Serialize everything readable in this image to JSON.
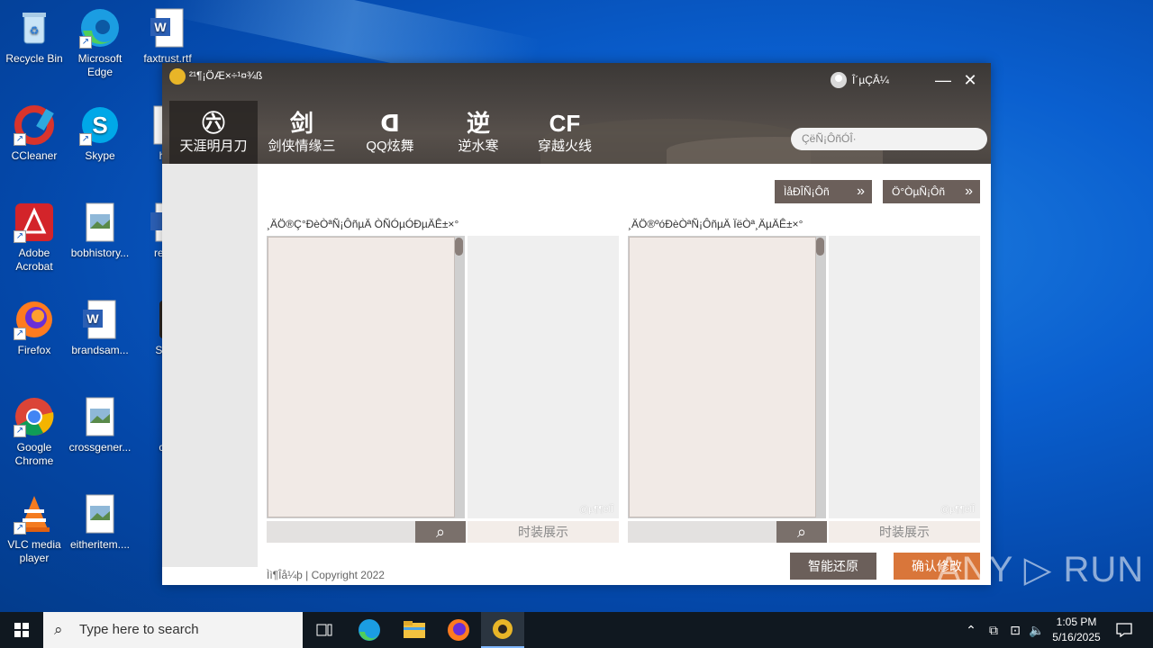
{
  "desktop": {
    "icons": [
      {
        "label": "Recycle Bin",
        "icon": "recycle-bin-icon"
      },
      {
        "label": "Microsoft Edge",
        "icon": "edge-icon"
      },
      {
        "label": "faxtrust.rtf",
        "icon": "word-doc-icon"
      },
      {
        "label": "CCleaner",
        "icon": "ccleaner-icon"
      },
      {
        "label": "Skype",
        "icon": "skype-icon"
      },
      {
        "label": "hist",
        "icon": "file-icon"
      },
      {
        "label": "Adobe Acrobat",
        "icon": "acrobat-icon"
      },
      {
        "label": "bobhistory...",
        "icon": "image-file-icon"
      },
      {
        "label": "ready",
        "icon": "word-doc-icon"
      },
      {
        "label": "Firefox",
        "icon": "firefox-icon"
      },
      {
        "label": "brandsam...",
        "icon": "word-doc-icon"
      },
      {
        "label": "Sigm",
        "icon": "app-icon"
      },
      {
        "label": "Google Chrome",
        "icon": "chrome-icon"
      },
      {
        "label": "crossgener...",
        "icon": "image-file-icon"
      },
      {
        "label": "con",
        "icon": "file-icon"
      },
      {
        "label": "VLC media player",
        "icon": "vlc-icon"
      },
      {
        "label": "eitheritem....",
        "icon": "image-file-icon"
      }
    ]
  },
  "app": {
    "title": "²¹¶¡ÖÆ×÷¹¤¾ß",
    "user_label": "Î´µÇÂ¼",
    "minimize": "—",
    "close": "✕",
    "tabs": [
      {
        "label": "天涯明月刀",
        "glyph": "㊅",
        "active": true
      },
      {
        "label": "剑侠情缘三",
        "glyph": "剑",
        "active": false
      },
      {
        "label": "QQ炫舞",
        "glyph": "ᗡ",
        "active": false
      },
      {
        "label": "逆水寒",
        "glyph": "逆",
        "active": false
      },
      {
        "label": "穿越火线",
        "glyph": "CF",
        "active": false
      }
    ],
    "search_placeholder": "ÇëÑ¡ÔñÓÎ·",
    "top_buttons": [
      {
        "label": "ÌåÐÎÑ¡Ôñ",
        "chevron": "»"
      },
      {
        "label": "Ö°ÒµÑ¡Ôñ",
        "chevron": "»"
      }
    ],
    "panels": [
      {
        "title": "¸ÄÖ®Ç°ÐèÒªÑ¡ÔñµÄ ÒÑÓµÓÐµÄÊ±×°",
        "watermark": "@µ¶¶éÍÎ",
        "preview_label": "时装展示",
        "search_icon": "⌕"
      },
      {
        "title": "¸ÄÖ®ºóÐèÒªÑ¡ÔñµÄ ÏëÒª¸ÄµÄÊ±×°",
        "watermark": "@µ¶¶éÍÎ",
        "preview_label": "时装展示",
        "search_icon": "⌕"
      }
    ],
    "copyright": "Ìì¶Îå¼þ | Copyright 2022",
    "action_buttons": [
      {
        "label": "智能还原",
        "color": "#6b5f5a"
      },
      {
        "label": "确认修改",
        "color": "#d9763a"
      }
    ]
  },
  "watermark_logo": "ANY ▷ RUN",
  "taskbar": {
    "search_placeholder": "Type here to search",
    "clock_time": "1:05 PM",
    "clock_date": "5/16/2025"
  },
  "colors": {
    "desktop_blue": "#0a5fcf",
    "header_dark": "#4a4542",
    "button_dark": "#6b5f5a",
    "button_orange": "#d9763a"
  }
}
